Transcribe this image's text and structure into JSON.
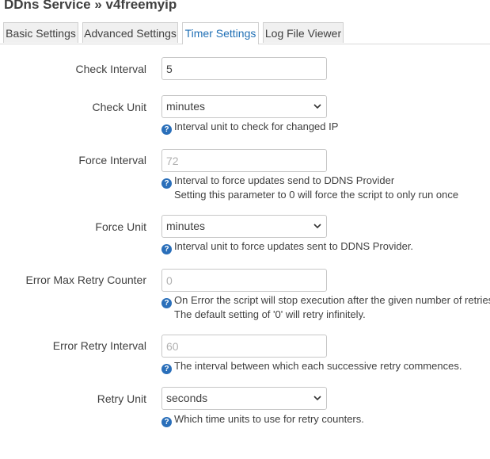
{
  "page": {
    "title": "DDns Service » v4freemyip"
  },
  "tabs": [
    {
      "label": "Basic Settings"
    },
    {
      "label": "Advanced Settings"
    },
    {
      "label": "Timer Settings"
    },
    {
      "label": "Log File Viewer"
    }
  ],
  "active_tab": "Timer Settings",
  "form": {
    "check_interval": {
      "label": "Check Interval",
      "value": "5",
      "placeholder": ""
    },
    "check_unit": {
      "label": "Check Unit",
      "value": "minutes",
      "hint": "Interval unit to check for changed IP"
    },
    "force_interval": {
      "label": "Force Interval",
      "value": "",
      "placeholder": "72",
      "hint_line1": "Interval to force updates send to DDNS Provider",
      "hint_line2": "Setting this parameter to 0 will force the script to only run once"
    },
    "force_unit": {
      "label": "Force Unit",
      "value": "minutes",
      "hint": "Interval unit to force updates sent to DDNS Provider."
    },
    "error_max_retry": {
      "label": "Error Max Retry Counter",
      "value": "",
      "placeholder": "0",
      "hint_line1": "On Error the script will stop execution after the given number of retries",
      "hint_line2": "The default setting of '0' will retry infinitely."
    },
    "error_retry_interval": {
      "label": "Error Retry Interval",
      "value": "",
      "placeholder": "60",
      "hint": "The interval between which each successive retry commences."
    },
    "retry_unit": {
      "label": "Retry Unit",
      "value": "seconds",
      "hint": "Which time units to use for retry counters."
    }
  },
  "icons": {
    "help": "help-icon",
    "dropdown": "chevron-down-icon"
  },
  "colors": {
    "accent": "#1f6fb5",
    "help_icon": "#2a6fba",
    "tab_bg": "#f0f0f0",
    "text": "#404040"
  }
}
